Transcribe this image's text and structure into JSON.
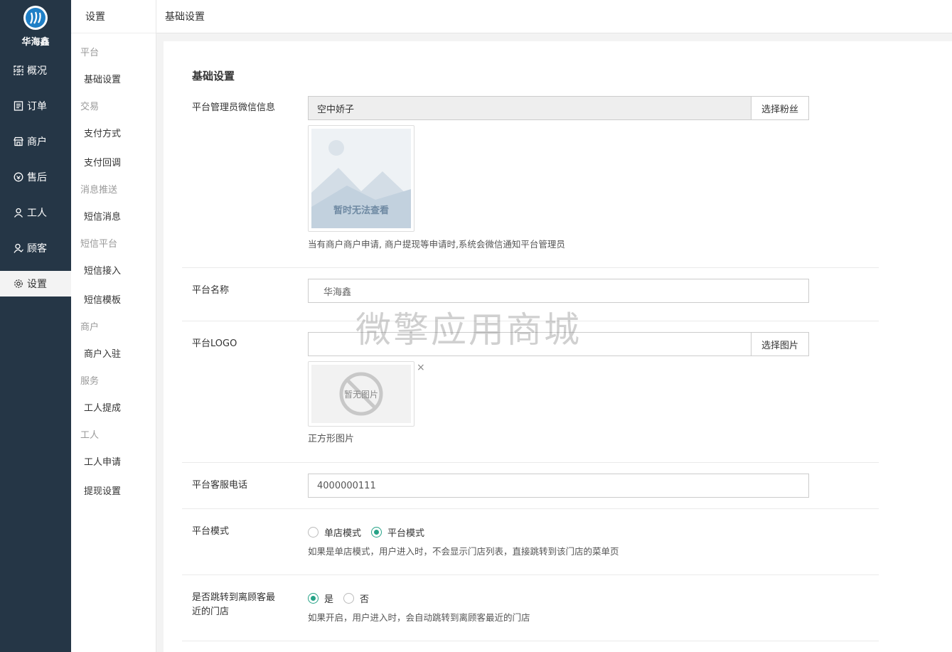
{
  "brand": {
    "name": "华海鑫",
    "accent": "#26a387",
    "nav_bg": "#253646"
  },
  "nav": {
    "items": [
      {
        "label": "概况",
        "icon": "dashboard-icon"
      },
      {
        "label": "订单",
        "icon": "order-icon"
      },
      {
        "label": "商户",
        "icon": "store-icon"
      },
      {
        "label": "售后",
        "icon": "after-sale-icon"
      },
      {
        "label": "工人",
        "icon": "worker-icon"
      },
      {
        "label": "顾客",
        "icon": "customer-icon"
      },
      {
        "label": "设置",
        "icon": "gear-icon",
        "active": true
      }
    ]
  },
  "subnav": {
    "title": "设置",
    "groups": [
      {
        "title": "平台",
        "links": [
          "基础设置"
        ]
      },
      {
        "title": "交易",
        "links": [
          "支付方式",
          "支付回调"
        ]
      },
      {
        "title": "消息推送",
        "links": [
          "短信消息"
        ]
      },
      {
        "title": "短信平台",
        "links": [
          "短信接入",
          "短信模板"
        ]
      },
      {
        "title": "商户",
        "links": [
          "商户入驻"
        ]
      },
      {
        "title": "服务",
        "links": [
          "工人提成"
        ]
      },
      {
        "title": "工人",
        "links": [
          "工人申请",
          "提现设置"
        ]
      }
    ]
  },
  "topbar": {
    "title": "基础设置"
  },
  "form": {
    "section_title": "基础设置",
    "admin_wechat": {
      "label": "平台管理员微信信息",
      "value": "空中娇子",
      "button": "选择粉丝",
      "image_text": "暂时无法查看",
      "help": "当有商户商户申请, 商户提现等申请时,系统会微信通知平台管理员"
    },
    "platform_name": {
      "label": "平台名称",
      "value": "华海鑫"
    },
    "platform_logo": {
      "label": "平台LOGO",
      "value": "",
      "button": "选择图片",
      "image_text": "暂无图片",
      "help": "正方形图片",
      "remove": "×"
    },
    "service_phone": {
      "label": "平台客服电话",
      "value": "4000000111"
    },
    "platform_mode": {
      "label": "平台模式",
      "options": [
        "单店模式",
        "平台模式"
      ],
      "selected": 1,
      "help": "如果是单店模式，用户进入时，不会显示门店列表，直接跳转到该门店的菜单页"
    },
    "jump_nearest": {
      "label_line1": "是否跳转到离顾客最",
      "label_line2": "近的门店",
      "options": [
        "是",
        "否"
      ],
      "selected": 0,
      "help": "如果开启，用户进入时，会自动跳转到离顾客最近的门店"
    }
  },
  "watermark": "微擎应用商城"
}
